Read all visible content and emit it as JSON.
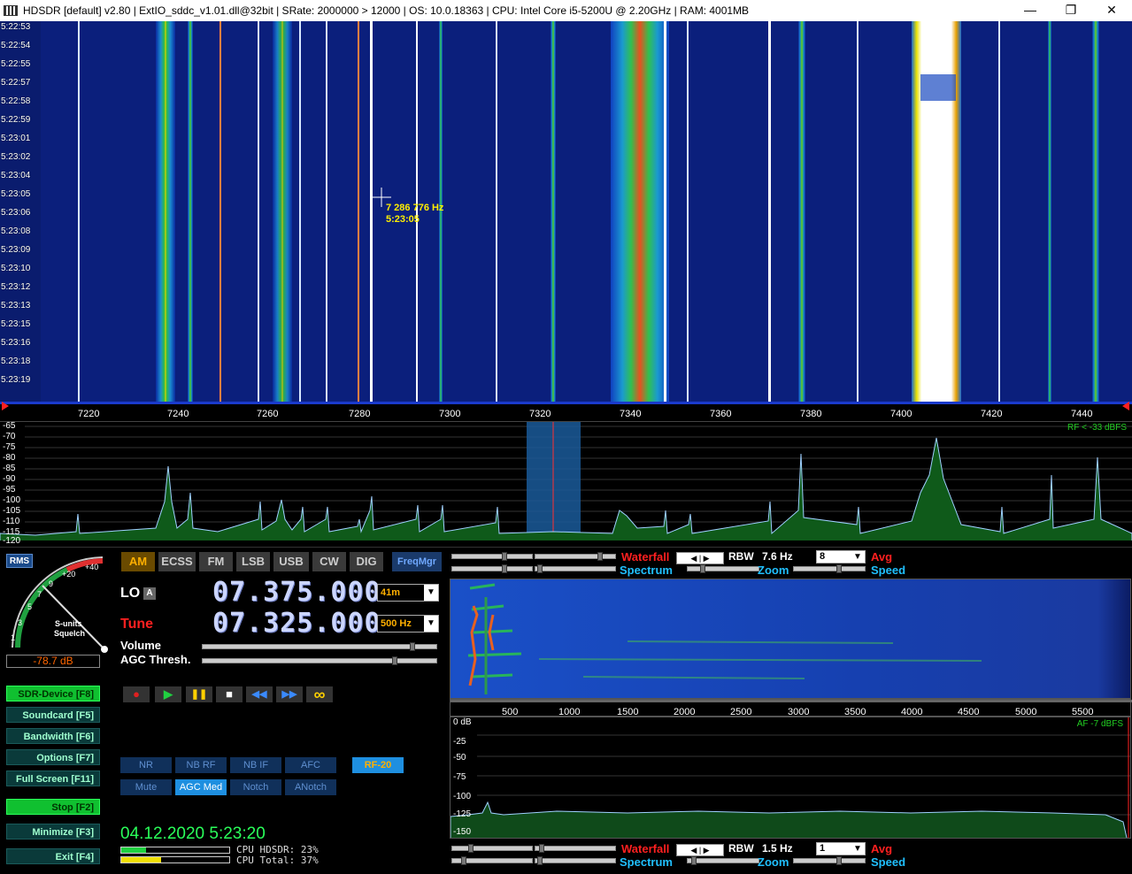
{
  "window": {
    "title": "HDSDR  [default]  v2.80   |  ExtIO_sddc_v1.01.dll@32bit  |  SRate: 2000000 > 12000  |  OS: 10.0.18363  |  CPU: Intel Core i5-5200U @ 2.20GHz  |  RAM: 4001MB",
    "minimize": "—",
    "maximize": "❐",
    "close": "✕"
  },
  "waterfall": {
    "timestamps": [
      "5:22:53",
      "5:22:54",
      "5:22:55",
      "5:22:57",
      "5:22:58",
      "5:22:59",
      "5:23:01",
      "5:23:02",
      "5:23:04",
      "5:23:05",
      "5:23:06",
      "5:23:08",
      "5:23:09",
      "5:23:10",
      "5:23:12",
      "5:23:13",
      "5:23:15",
      "5:23:16",
      "5:23:18",
      "5:23:19"
    ],
    "cursor_freq": "7 286 776 Hz",
    "cursor_time": "5:23:05"
  },
  "freq_axis": {
    "labels": [
      "7220",
      "7240",
      "7260",
      "7280",
      "7300",
      "7320",
      "7340",
      "7360",
      "7380",
      "7400",
      "7420",
      "7440"
    ]
  },
  "spectrum": {
    "db_labels": [
      "-65",
      "-70",
      "-75",
      "-80",
      "-85",
      "-90",
      "-95",
      "-100",
      "-105",
      "-110",
      "-115",
      "-120"
    ],
    "rf_note": "RF < -33 dBFS"
  },
  "smeter": {
    "rms_label": "RMS",
    "scale": [
      "1",
      "3",
      "5",
      "7",
      "9",
      "+20",
      "+40"
    ],
    "caption1": "S-units",
    "caption2": "Squelch",
    "reading": "-78.7 dB"
  },
  "side_buttons": [
    {
      "label": "SDR-Device [F8]",
      "active": true
    },
    {
      "label": "Soundcard  [F5]",
      "active": false
    },
    {
      "label": "Bandwidth  [F6]",
      "active": false
    },
    {
      "label": "Options    [F7]",
      "active": false
    },
    {
      "label": "Full Screen [F11]",
      "active": false
    },
    {
      "label": "Stop       [F2]",
      "active": true
    },
    {
      "label": "Minimize  [F3]",
      "active": false
    },
    {
      "label": "Exit      [F4]",
      "active": false
    }
  ],
  "modes": [
    {
      "label": "AM",
      "active": true
    },
    {
      "label": "ECSS",
      "active": false
    },
    {
      "label": "FM",
      "active": false
    },
    {
      "label": "LSB",
      "active": false
    },
    {
      "label": "USB",
      "active": false
    },
    {
      "label": "CW",
      "active": false
    },
    {
      "label": "DIG",
      "active": false
    }
  ],
  "freqmgr": "FreqMgr",
  "lo": {
    "label": "LO",
    "badge": "A",
    "freq": "07.375.000",
    "band": "41m"
  },
  "tune": {
    "label": "Tune",
    "freq": "07.325.000",
    "step": "500 Hz"
  },
  "volume_label": "Volume",
  "agc_label": "AGC Thresh.",
  "playback": [
    "●",
    "▶",
    "❚❚",
    "■",
    "◀◀",
    "▶▶",
    "∞"
  ],
  "dsp_row1": [
    {
      "label": "NR",
      "active": false
    },
    {
      "label": "NB RF",
      "active": false
    },
    {
      "label": "NB IF",
      "active": false
    },
    {
      "label": "AFC",
      "active": false
    }
  ],
  "rf20": "RF-20",
  "dsp_row2": [
    {
      "label": "Mute",
      "active": false
    },
    {
      "label": "AGC Med",
      "active": true
    },
    {
      "label": "Notch",
      "active": false
    },
    {
      "label": "ANotch",
      "active": false
    }
  ],
  "datetime": "04.12.2020 5:23:20",
  "cpu": {
    "hdsdr": "CPU HDSDR: 23%",
    "total": "CPU Total: 37%",
    "hdsdr_pct": 23,
    "total_pct": 37
  },
  "rf_controls": {
    "waterfall": "Waterfall",
    "spectrum": "Spectrum",
    "rbw_label": "RBW",
    "rbw": "7.6 Hz",
    "avg_value": "8",
    "avg": "Avg",
    "zoom": "Zoom",
    "speed": "Speed"
  },
  "af_axis": {
    "labels": [
      "500",
      "1000",
      "1500",
      "2000",
      "2500",
      "3000",
      "3500",
      "4000",
      "4500",
      "5000",
      "5500"
    ]
  },
  "af_spectrum": {
    "db_labels": [
      "0 dB",
      "-25",
      "-50",
      "-75",
      "-100",
      "-125",
      "-150"
    ],
    "af_note": "AF  -7 dBFS"
  },
  "af_controls": {
    "waterfall": "Waterfall",
    "spectrum": "Spectrum",
    "rbw_label": "RBW",
    "rbw": "1.5 Hz",
    "avg_value": "1",
    "avg": "Avg",
    "zoom": "Zoom",
    "speed": "Speed"
  }
}
